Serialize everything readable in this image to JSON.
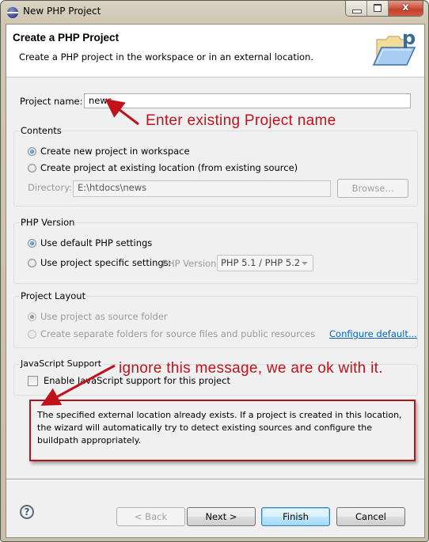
{
  "window": {
    "title": "New PHP Project",
    "controls": {
      "minimize": "minimize",
      "maximize": "maximize",
      "close": "x"
    }
  },
  "header": {
    "title": "Create a PHP Project",
    "description": "Create a PHP project in the workspace or in an external location.",
    "icon": "php-folder-icon"
  },
  "project_name": {
    "label": "Project name:",
    "value": "news"
  },
  "contents": {
    "title": "Contents",
    "options": [
      {
        "label": "Create new project in workspace",
        "checked": true
      },
      {
        "label": "Create project at existing location (from existing source)",
        "checked": false
      }
    ],
    "directory_label": "Directory:",
    "directory_value": "E:\\htdocs\\news",
    "browse_label": "Browse..."
  },
  "php_version": {
    "title": "PHP Version",
    "options": [
      {
        "label": "Use default PHP settings",
        "checked": true
      },
      {
        "label": "Use project specific settings:",
        "checked": false
      }
    ],
    "version_label": "PHP Version:",
    "version_selected": "PHP 5.1 / PHP 5.2"
  },
  "project_layout": {
    "title": "Project Layout",
    "options": [
      {
        "label": "Use project as source folder",
        "checked": true
      },
      {
        "label": "Create separate folders for source files and public resources",
        "checked": false
      }
    ],
    "configure_link": "Configure default..."
  },
  "javascript_support": {
    "title": "JavaScript Support",
    "checkbox_label": "Enable JavaScript support for this project",
    "checked": false
  },
  "message": "The specified external location already exists. If a project is created in this location, the wizard will automatically try to detect existing sources and configure the buildpath appropriately.",
  "annotations": {
    "name_hint": "Enter existing Project name",
    "message_hint": "ignore this message, we are ok with it.",
    "color": "#c1121c"
  },
  "footer": {
    "help_icon": "?",
    "back_label": "< Back",
    "next_label": "Next >",
    "finish_label": "Finish",
    "cancel_label": "Cancel"
  }
}
